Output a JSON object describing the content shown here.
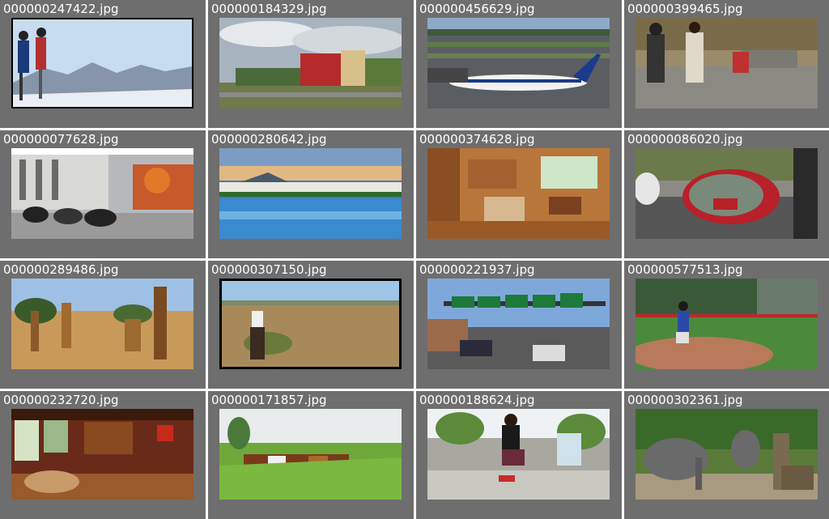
{
  "tiles": [
    {
      "filename": "000000247422.jpg"
    },
    {
      "filename": "000000184329.jpg"
    },
    {
      "filename": "000000456629.jpg"
    },
    {
      "filename": "000000399465.jpg"
    },
    {
      "filename": "000000077628.jpg"
    },
    {
      "filename": "000000280642.jpg"
    },
    {
      "filename": "000000374628.jpg"
    },
    {
      "filename": "000000086020.jpg"
    },
    {
      "filename": "000000289486.jpg"
    },
    {
      "filename": "000000307150.jpg"
    },
    {
      "filename": "000000221937.jpg"
    },
    {
      "filename": "000000577513.jpg"
    },
    {
      "filename": "000000232720.jpg"
    },
    {
      "filename": "000000171857.jpg"
    },
    {
      "filename": "000000188624.jpg"
    },
    {
      "filename": "000000302361.jpg"
    }
  ]
}
